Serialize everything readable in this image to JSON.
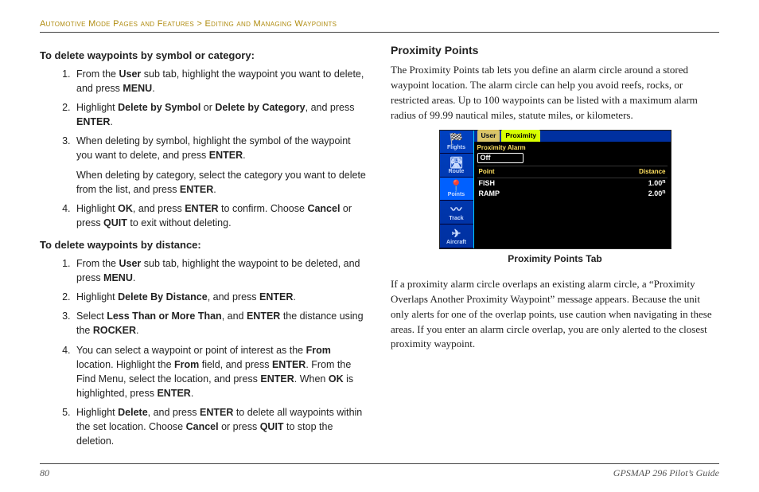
{
  "breadcrumb": {
    "part1": "Automotive Mode Pages and Features",
    "sep": " > ",
    "part2": "Editing and Managing Waypoints"
  },
  "left": {
    "h1": "To delete waypoints by symbol or category:",
    "steps1": {
      "s1a": "From the ",
      "s1b": "User",
      "s1c": " sub tab, highlight the waypoint you want to delete, and press ",
      "s1d": "MENU",
      "s1e": ".",
      "s2a": "Highlight ",
      "s2b": "Delete by Symbol",
      "s2c": " or ",
      "s2d": "Delete by Category",
      "s2e": ", and press ",
      "s2f": "ENTER",
      "s2g": ".",
      "s3a": "When deleting by symbol, highlight the symbol of the waypoint you want to delete, and press ",
      "s3b": "ENTER",
      "s3c": ".",
      "s3d": "When deleting by category, select the category you want to delete from the list, and press ",
      "s3e": "ENTER",
      "s3f": ".",
      "s4a": "Highlight ",
      "s4b": "OK",
      "s4c": ", and press ",
      "s4d": "ENTER",
      "s4e": " to confirm. Choose ",
      "s4f": "Cancel",
      "s4g": " or press ",
      "s4h": "QUIT",
      "s4i": " to exit without deleting."
    },
    "h2": "To delete waypoints by distance:",
    "steps2": {
      "s1a": "From the ",
      "s1b": "User",
      "s1c": " sub tab, highlight the waypoint to be deleted, and press ",
      "s1d": "MENU",
      "s1e": ".",
      "s2a": "Highlight ",
      "s2b": "Delete By Distance",
      "s2c": ", and press ",
      "s2d": "ENTER",
      "s2e": ".",
      "s3a": "Select ",
      "s3b": "Less Than or More Than",
      "s3c": ", and ",
      "s3d": "ENTER",
      "s3e": " the distance using the ",
      "s3f": "ROCKER",
      "s3g": ".",
      "s4a": "You can select a waypoint or point of interest as the ",
      "s4b": "From",
      "s4c": " location. Highlight the ",
      "s4d": "From",
      "s4e": " field, and press ",
      "s4f": "ENTER",
      "s4g": ". From the Find Menu, select the location, and press ",
      "s4h": "ENTER",
      "s4i": ". When ",
      "s4j": "OK",
      "s4k": " is highlighted, press ",
      "s4l": "ENTER",
      "s4m": ".",
      "s5a": "Highlight ",
      "s5b": "Delete",
      "s5c": ", and press ",
      "s5d": "ENTER",
      "s5e": " to delete all waypoints within the set location. Choose ",
      "s5f": "Cancel",
      "s5g": " or press ",
      "s5h": "QUIT",
      "s5i": " to stop the deletion."
    }
  },
  "right": {
    "title": "Proximity Points",
    "p1": "The Proximity Points tab lets you define an alarm circle around a stored waypoint location. The alarm circle can help you avoid reefs, rocks, or restricted areas. Up to 100 waypoints can be listed with a maximum alarm radius of 99.99 nautical miles, statute miles, or kilometers.",
    "caption": "Proximity Points Tab",
    "p2": "If a proximity alarm circle overlaps an existing alarm circle, a “Proximity Overlaps Another Proximity Waypoint” message appears. Because the unit only alerts for one of the overlap points, use caution when navigating in these areas. If you enter an alarm circle overlap, you are only alerted to the closest proximity waypoint."
  },
  "gps": {
    "side": [
      "Flights",
      "Route",
      "Points",
      "Track",
      "Aircraft"
    ],
    "tabs": {
      "inactive": "User",
      "active": "Proximity"
    },
    "alarmLabel": "Proximity Alarm",
    "alarmValue": "Off",
    "hdr": {
      "point": "Point",
      "dist": "Distance"
    },
    "rows": [
      {
        "name": "FISH",
        "dist": "1.00",
        "unit": "n"
      },
      {
        "name": "RAMP",
        "dist": "2.00",
        "unit": "n"
      }
    ]
  },
  "footer": {
    "page": "80",
    "book": "GPSMAP 296 Pilot’s Guide"
  }
}
